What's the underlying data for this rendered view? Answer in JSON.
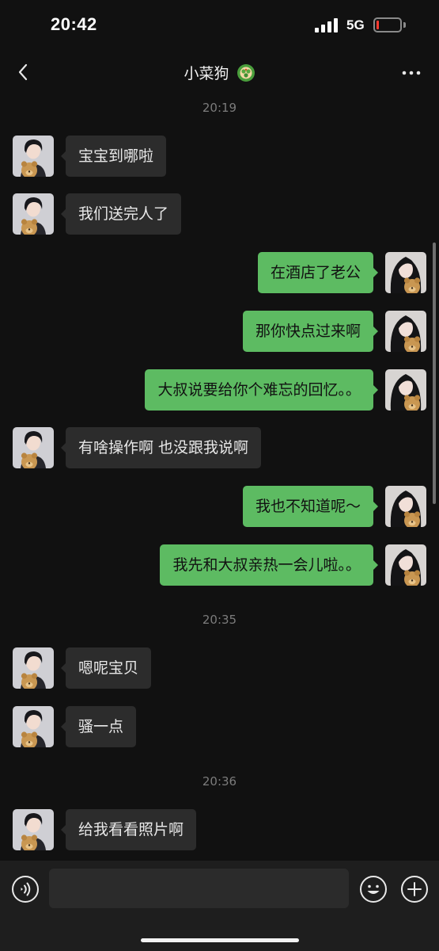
{
  "status_bar": {
    "time": "20:42",
    "network": "5G",
    "battery_level": 0.1,
    "battery_color": "#ff3b30"
  },
  "nav": {
    "title": "小菜狗",
    "title_emoji_icon": "vegetable-emoji-icon",
    "back_icon": "chevron-left-icon",
    "more_icon": "more-dots-icon"
  },
  "chat": {
    "timestamps": [
      "20:19",
      "20:35",
      "20:36"
    ],
    "messages": [
      {
        "side": "in",
        "text": "宝宝到哪啦"
      },
      {
        "side": "in",
        "text": "我们送完人了"
      },
      {
        "side": "out",
        "text": "在酒店了老公"
      },
      {
        "side": "out",
        "text": "那你快点过来啊"
      },
      {
        "side": "out",
        "text": "大叔说要给你个难忘的回忆。。"
      },
      {
        "side": "in",
        "text": "有啥操作啊 也没跟我说啊"
      },
      {
        "side": "out",
        "text": "我也不知道呢～"
      },
      {
        "side": "out",
        "text": "我先和大叔亲热一会儿啦。。"
      },
      {
        "side": "in",
        "text": "嗯呢宝贝"
      },
      {
        "side": "in",
        "text": "骚一点"
      },
      {
        "side": "in",
        "text": "给我看看照片啊"
      }
    ]
  },
  "input_bar": {
    "placeholder": "",
    "value": "",
    "voice_icon": "voice-icon",
    "emoji_icon": "emoji-icon",
    "plus_icon": "plus-icon"
  },
  "colors": {
    "background": "#111111",
    "incoming_bubble": "#2c2c2c",
    "outgoing_bubble": "#5dbb62",
    "timestamp_text": "#7c7c7c"
  }
}
